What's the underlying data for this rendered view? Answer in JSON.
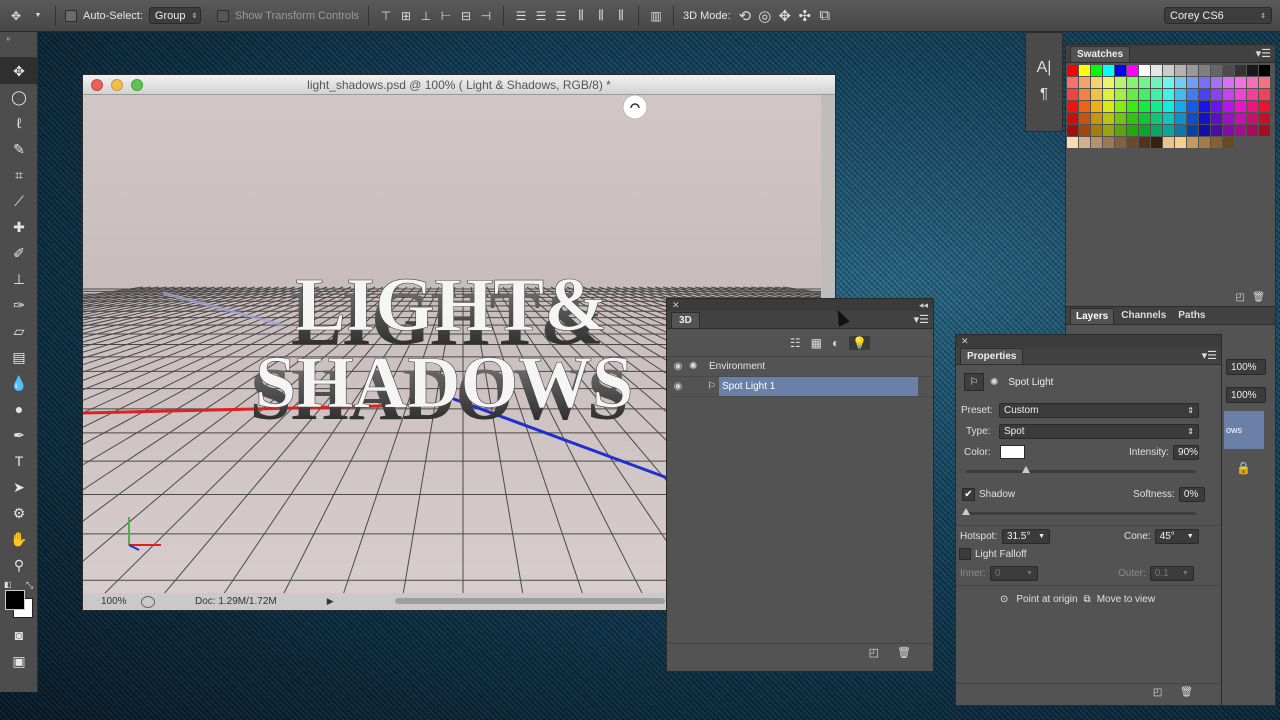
{
  "options_bar": {
    "auto_select_label": "Auto-Select:",
    "auto_select_value": "Group",
    "show_transform_label": "Show Transform Controls",
    "mode_3d_label": "3D Mode:",
    "workspace_value": "Corey CS6"
  },
  "document": {
    "title": "light_shadows.psd @ 100% (  Light & Shadows, RGB/8) *",
    "zoom": "100%",
    "doc_info": "Doc: 1.29M/1.72M",
    "scene_line1": "LIGHT&",
    "scene_line2": "SHADOWS"
  },
  "panel_3d": {
    "tab_label": "3D",
    "rows": [
      {
        "label": "Environment"
      },
      {
        "label": "Spot Light 1"
      }
    ]
  },
  "properties": {
    "tab_label": "Properties",
    "light_type_title": "Spot Light",
    "preset_label": "Preset:",
    "preset_value": "Custom",
    "type_label": "Type:",
    "type_value": "Spot",
    "color_label": "Color:",
    "light_color": "#ffffff",
    "intensity_label": "Intensity:",
    "intensity_value": "90%",
    "shadow_label": "Shadow",
    "softness_label": "Softness:",
    "softness_value": "0%",
    "hotspot_label": "Hotspot:",
    "hotspot_value": "31.5°",
    "cone_label": "Cone:",
    "cone_value": "45°",
    "light_falloff_label": "Light Falloff",
    "inner_label": "Inner:",
    "inner_value": "0",
    "outer_label": "Outer:",
    "outer_value": "0.1",
    "point_at_origin_label": "Point at origin",
    "move_to_view_label": "Move to view"
  },
  "swatches": {
    "tab_label": "Swatches"
  },
  "layers_panel": {
    "tabs": [
      "Layers",
      "Channels",
      "Paths"
    ],
    "opacity_value": "100%",
    "fill_value": "100%",
    "layer_text_fragment": "ows"
  },
  "colors": {
    "selection": "#6b80a8",
    "axis_red": "#e02020",
    "axis_blue": "#1f2fd0",
    "axis_green": "#4fb04f"
  }
}
